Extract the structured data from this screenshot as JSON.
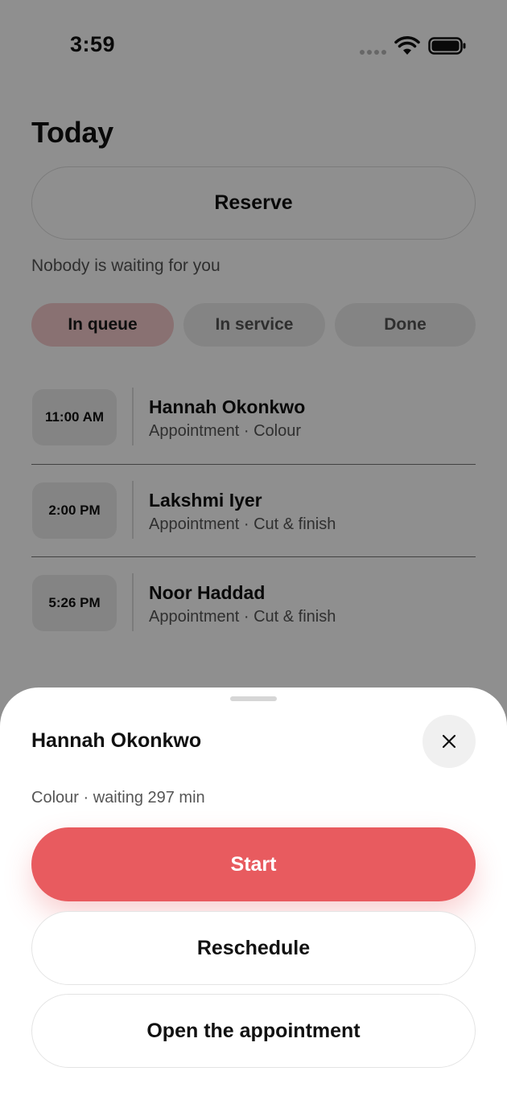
{
  "status_bar": {
    "time": "3:59",
    "icons": [
      "cellular-signal-icon",
      "wifi-icon",
      "battery-icon"
    ]
  },
  "page": {
    "title": "Today",
    "reserve_label": "Reserve",
    "waiting_note": "Nobody is waiting for you"
  },
  "tabs": [
    {
      "label": "In queue",
      "active": true
    },
    {
      "label": "In service",
      "active": false
    },
    {
      "label": "Done",
      "active": false
    }
  ],
  "appointments": [
    {
      "time": "11:00 AM",
      "name": "Hannah Okonkwo",
      "meta": "Appointment · Colour"
    },
    {
      "time": "2:00 PM",
      "name": "Lakshmi Iyer",
      "meta": "Appointment · Cut & finish"
    },
    {
      "time": "5:26 PM",
      "name": "Noor Haddad",
      "meta": "Appointment · Cut & finish"
    }
  ],
  "sheet": {
    "title": "Hannah Okonkwo",
    "subtitle": "Colour · waiting 297 min",
    "start_label": "Start",
    "reschedule_label": "Reschedule",
    "open_label": "Open the appointment",
    "close_icon": "close-icon"
  },
  "colors": {
    "accent": "#e85b5f",
    "active_tab_bg": "#f5c9cb",
    "overlay": "rgba(0,0,0,0.44)"
  }
}
